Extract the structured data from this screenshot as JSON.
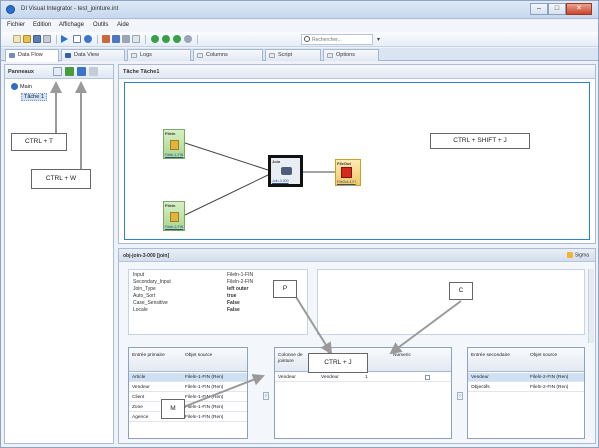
{
  "window": {
    "title": "DI Visual Integrator - test_jointure.int",
    "min_label": "–",
    "max_label": "□",
    "close_label": "✕"
  },
  "menu": [
    "Fichier",
    "Edition",
    "Affichage",
    "Outils",
    "Aide"
  ],
  "search": {
    "placeholder": "Rechercher...",
    "dropdown": "▾"
  },
  "tabs": [
    "Data Flow",
    "Data View",
    "Logs",
    "Columns",
    "Script",
    "Options"
  ],
  "left_panel": {
    "title": "Panneaux",
    "tree_root": "Main",
    "tree_child": "Tâche 1"
  },
  "canvas_panel": {
    "title": "Tâche Tâche1",
    "source1": {
      "label": "Fileln",
      "sub": "Fileln-1-FIN"
    },
    "source2": {
      "label": "Fileln",
      "sub": "Fileln-2-FIN"
    },
    "join": {
      "label": "Join",
      "sub": "Join-3-000"
    },
    "output": {
      "label": "FileOut",
      "sub": "FileOut-4-FI"
    }
  },
  "callouts": {
    "ctrl_t": "CTRL + T",
    "ctrl_w": "CTRL + W",
    "ctrl_shift_j": "CTRL + SHIFT + J",
    "p": "P",
    "c": "C",
    "ctrl_j": "CTRL + J",
    "m": "M"
  },
  "props_panel": {
    "title": "obj-join-3-000 [join]",
    "sigma_label": "Sigma",
    "properties": [
      {
        "name": "Input",
        "value": "Fileln-1-FIN",
        "bold": false
      },
      {
        "name": "Secondary_Input",
        "value": "Fileln-2-FIN",
        "bold": false
      },
      {
        "name": "Join_Type",
        "value": "left outer",
        "bold": true
      },
      {
        "name": "Auto_Sort",
        "value": "true",
        "bold": true
      },
      {
        "name": "Case_Sensitive",
        "value": "False",
        "bold": true
      },
      {
        "name": "Locale",
        "value": "False",
        "bold": true
      }
    ]
  },
  "primary_grid": {
    "header1": "Entrée primaire",
    "header2": "Objet source",
    "rows": [
      {
        "col1": "Article",
        "col2": "Fileln-1-FIN (Ren)",
        "selected": true
      },
      {
        "col1": "Vendeur",
        "col2": "Fileln-1-FIN (Ren)",
        "selected": false
      },
      {
        "col1": "Client",
        "col2": "Fileln-1-FIN (Ren)",
        "selected": false
      },
      {
        "col1": "Zone",
        "col2": "Fileln-1-FIN (Ren)",
        "selected": false
      },
      {
        "col1": "Agence",
        "col2": "Fileln-1-FIN (Ren)",
        "selected": false
      }
    ]
  },
  "key_grid": {
    "header1": "Colonne de jointure",
    "header2": "Colonne secondaire",
    "header3": "Numeric",
    "rows": [
      {
        "col1": "Vendeur",
        "col2": "Vendeur",
        "col3": "1"
      }
    ]
  },
  "secondary_grid": {
    "header1": "Entrée secondaire",
    "header2": "Objet source",
    "rows": [
      {
        "col1": "Vendeur",
        "col2": "Fileln-2-FIN (Ren)",
        "selected": true
      },
      {
        "col1": "Objectifs",
        "col2": "Fileln-2-FIN (Ren)",
        "selected": false
      }
    ]
  },
  "colors": {
    "accent": "#2f7fd0",
    "node_green": "#a8d68e",
    "node_output": "#f0c868",
    "join_border": "#111111"
  }
}
